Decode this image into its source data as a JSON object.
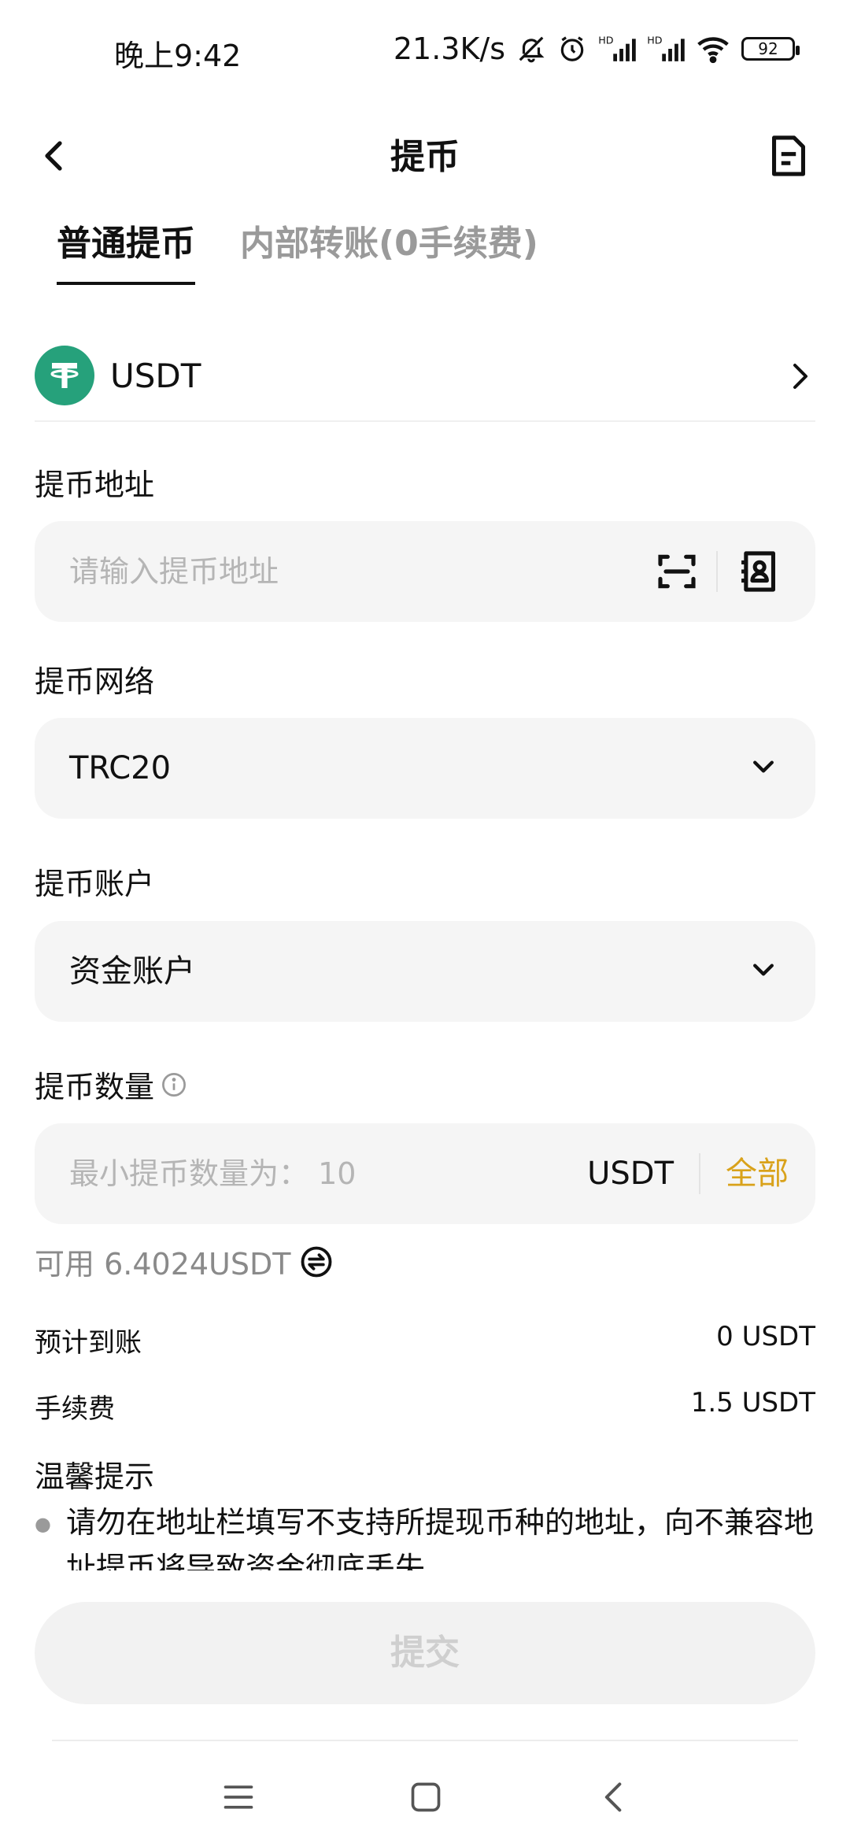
{
  "status_bar": {
    "time": "晚上9:42",
    "net_speed": "21.3K/s",
    "battery": "92",
    "icons": [
      "mute-icon",
      "alarm-icon",
      "hd-signal-icon",
      "hd-signal-icon",
      "wifi-icon",
      "battery-icon"
    ]
  },
  "nav": {
    "title": "提币",
    "back_icon": "back-arrow-icon",
    "record_icon": "record-list-icon"
  },
  "tabs": [
    {
      "label": "普通提币",
      "active": true
    },
    {
      "label": "内部转账(0手续费)",
      "active": false
    }
  ],
  "coin": {
    "logo_glyph": "T",
    "name": "USDT",
    "color": "#26a17b"
  },
  "address": {
    "label": "提币地址",
    "placeholder": "请输入提币地址"
  },
  "network": {
    "label": "提币网络",
    "value": "TRC20"
  },
  "account": {
    "label": "提币账户",
    "value": "资金账户"
  },
  "amount": {
    "label": "提币数量",
    "placeholder": "最小提币数量为： 10",
    "unit": "USDT",
    "all_label": "全部",
    "accent_color": "#d9a21b"
  },
  "available": {
    "text": "可用 6.4024USDT"
  },
  "summary": [
    {
      "label": "预计到账",
      "value": "0 USDT"
    },
    {
      "label": "手续费",
      "value": "1.5 USDT"
    }
  ],
  "tips": {
    "title": "温馨提示",
    "items": [
      "请勿在地址栏填写不支持所提现币种的地址，向不兼容地址提币将导致资金彻底丢失。"
    ]
  },
  "submit": {
    "label": "提交"
  }
}
